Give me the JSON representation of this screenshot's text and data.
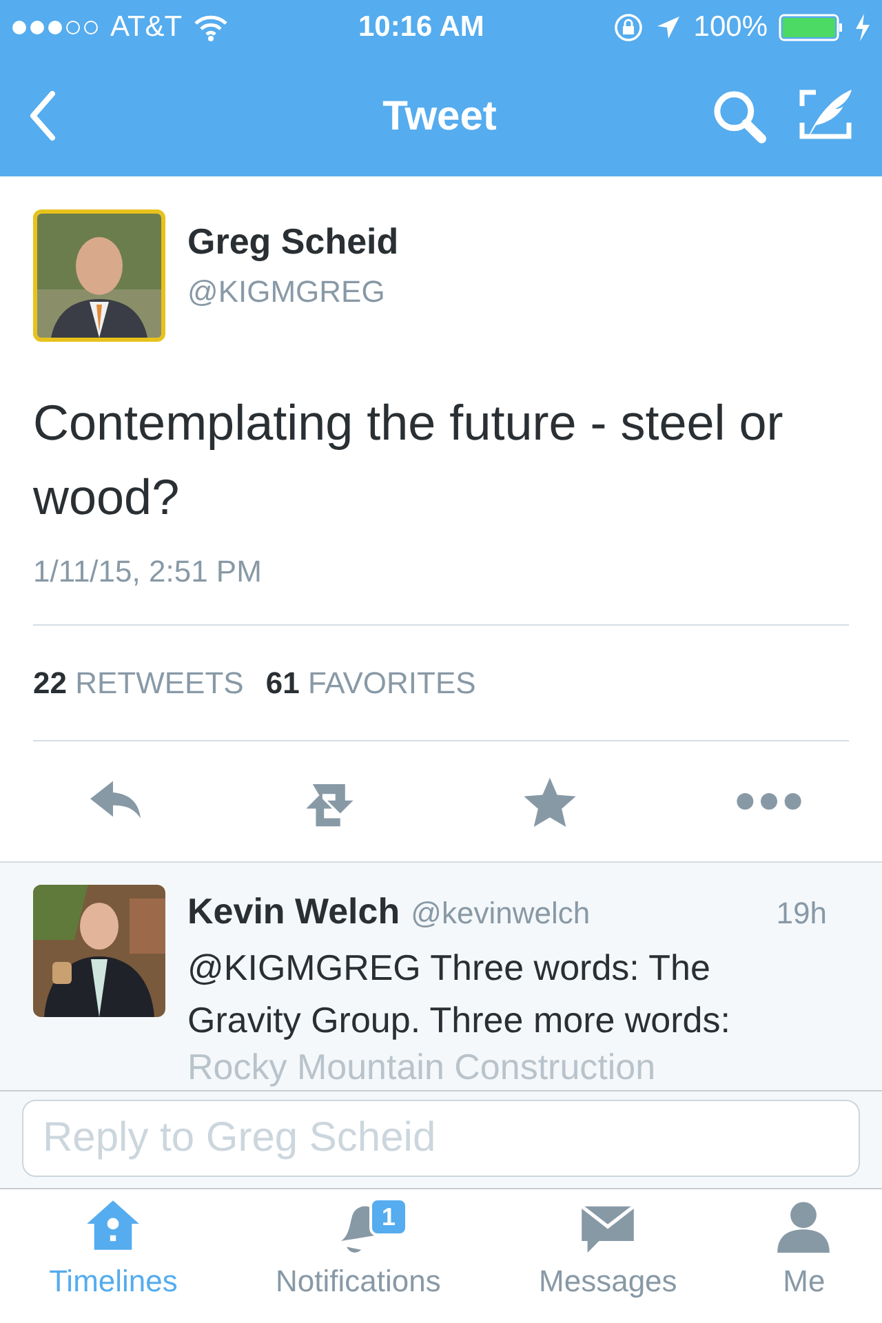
{
  "status_bar": {
    "carrier": "AT&T",
    "time": "10:16 AM",
    "battery": "100%"
  },
  "nav": {
    "title": "Tweet"
  },
  "tweet": {
    "author_name": "Greg Scheid",
    "author_handle": "@KIGMGREG",
    "text": "Contemplating the future - steel or wood?",
    "timestamp": "1/11/15, 2:51 PM",
    "stats": [
      {
        "count": "22",
        "label": "RETWEETS"
      },
      {
        "count": "61",
        "label": "FAVORITES"
      }
    ]
  },
  "reply": {
    "name": "Kevin Welch",
    "handle": "@kevinwelch",
    "time": "19h",
    "text": "@KIGMGREG Three words: The Gravity Group. Three more words:",
    "faded_text": "Rocky Mountain Construction"
  },
  "compose": {
    "placeholder": "Reply to Greg Scheid"
  },
  "tabs": [
    {
      "kind": "home",
      "label": "Timelines",
      "selected": true
    },
    {
      "kind": "bell",
      "label": "Notifications",
      "selected": false,
      "badge": "1"
    },
    {
      "kind": "mail",
      "label": "Messages",
      "selected": false
    },
    {
      "kind": "person",
      "label": "Me",
      "selected": false
    }
  ]
}
